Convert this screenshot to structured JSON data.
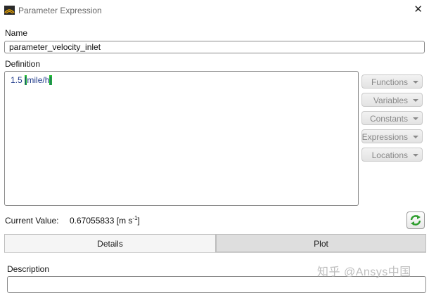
{
  "window": {
    "title": "Parameter Expression",
    "close_glyph": "✕"
  },
  "name": {
    "label": "Name",
    "value": "parameter_velocity_inlet"
  },
  "definition": {
    "label": "Definition",
    "number": "1.5 ",
    "unit_open": "[",
    "unit": "mile/h",
    "unit_close": "]"
  },
  "side_buttons": [
    {
      "label": "Functions"
    },
    {
      "label": "Variables"
    },
    {
      "label": "Constants"
    },
    {
      "label": "Expressions"
    },
    {
      "label": "Locations"
    }
  ],
  "current_value": {
    "label": "Current Value:",
    "value": "0.67055833 [m s",
    "exponent": "-1",
    "suffix": "]"
  },
  "tabs": [
    {
      "label": "Details"
    },
    {
      "label": "Plot"
    }
  ],
  "details": {
    "description_label": "Description",
    "description_value": ""
  },
  "watermark": "知乎 @Ansys中国",
  "colors": {
    "unit_highlight": "#22c22e",
    "code_text": "#1f3a8a",
    "disabled_text": "#8a8a8a"
  },
  "icons": {
    "app": "ansys-app-icon",
    "refresh": "refresh-icon",
    "dropdown": "chevron-down-icon"
  }
}
